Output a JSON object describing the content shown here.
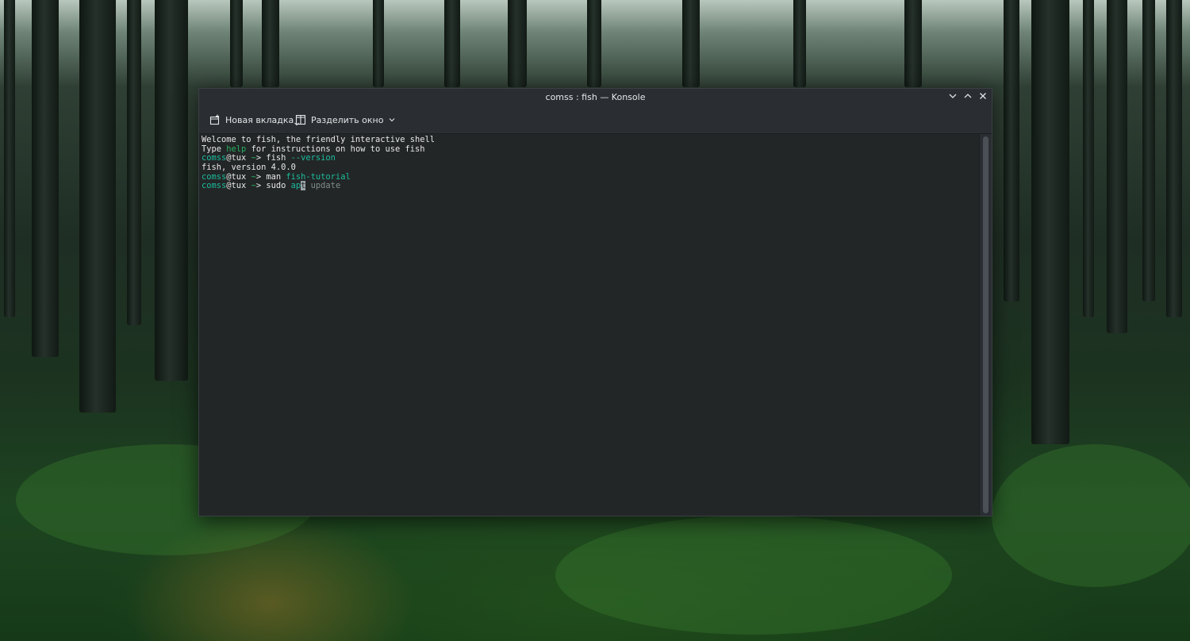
{
  "window": {
    "title": "comss : fish — Konsole",
    "controls": {
      "minimize": "minimize-icon",
      "maximize": "maximize-icon",
      "close": "close-icon"
    }
  },
  "toolbar": {
    "new_tab_label": "Новая вкладка",
    "split_view_label": "Разделить окно"
  },
  "terminal": {
    "lines": [
      {
        "segments": [
          {
            "text": "Welcome to fish, the friendly interactive shell",
            "style": "plain"
          }
        ]
      },
      {
        "segments": [
          {
            "text": "Type ",
            "style": "plain"
          },
          {
            "text": "help",
            "style": "green"
          },
          {
            "text": " for instructions on how to use fish",
            "style": "plain"
          }
        ]
      },
      {
        "segments": [
          {
            "text": "comss",
            "style": "user"
          },
          {
            "text": "@tux ",
            "style": "plain"
          },
          {
            "text": "~",
            "style": "green"
          },
          {
            "text": "> fish ",
            "style": "plain"
          },
          {
            "text": "--version",
            "style": "param"
          }
        ]
      },
      {
        "segments": [
          {
            "text": "fish, version 4.0.0",
            "style": "plain"
          }
        ]
      },
      {
        "segments": [
          {
            "text": "comss",
            "style": "user"
          },
          {
            "text": "@tux ",
            "style": "plain"
          },
          {
            "text": "~",
            "style": "green"
          },
          {
            "text": "> man ",
            "style": "plain"
          },
          {
            "text": "fish-tutorial",
            "style": "param"
          }
        ]
      },
      {
        "segments": [
          {
            "text": "comss",
            "style": "user"
          },
          {
            "text": "@tux ",
            "style": "plain"
          },
          {
            "text": "~",
            "style": "green"
          },
          {
            "text": "> sudo ",
            "style": "plain"
          },
          {
            "text": "ap",
            "style": "param"
          },
          {
            "text": "t",
            "style": "cursor"
          },
          {
            "text": " update",
            "style": "grey"
          }
        ]
      }
    ]
  },
  "colors": {
    "user": "#1abc9c",
    "green": "#27ae60",
    "param": "#1abc9c",
    "grey": "#7f8c8d",
    "background": "#232627"
  }
}
